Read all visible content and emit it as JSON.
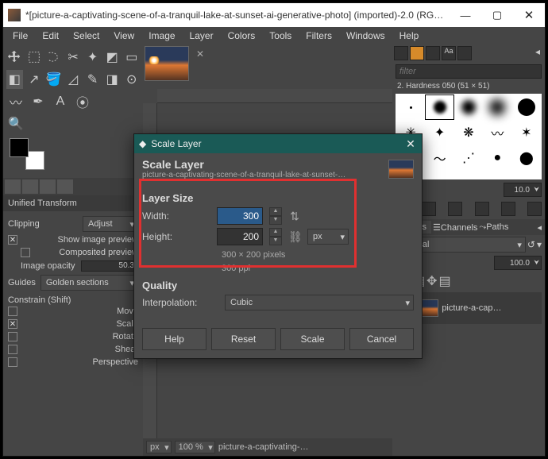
{
  "window": {
    "title": "*[picture-a-captivating-scene-of-a-tranquil-lake-at-sunset-ai-generative-photo] (imported)-2.0 (RG…"
  },
  "menu": [
    "File",
    "Edit",
    "Select",
    "View",
    "Image",
    "Layer",
    "Colors",
    "Tools",
    "Filters",
    "Windows",
    "Help"
  ],
  "tool_options": {
    "title": "Unified Transform",
    "clipping_label": "Clipping",
    "clipping_value": "Adjust",
    "show_preview": "Show image preview",
    "composited": "Composited preview",
    "opacity_label": "Image opacity",
    "opacity_value": "50.3",
    "guides_label": "Guides",
    "guides_value": "Golden sections",
    "constrain": "Constrain (Shift)",
    "c_move": "Move",
    "c_scale": "Scale",
    "c_rotate": "Rotate",
    "c_shear": "Shear",
    "c_persp": "Perspective"
  },
  "right": {
    "filter_placeholder": "filter",
    "brush_label": "2. Hardness 050 (51 × 51)",
    "brush_size": "10.0",
    "tabs": {
      "layers": "Layers",
      "channels": "Channels",
      "paths": "Paths"
    },
    "mode": "Normal",
    "opacity": "100.0",
    "layer_name": "picture-a-cap…"
  },
  "status": {
    "unit": "px",
    "zoom": "100 %",
    "filename": "picture-a-captivating-…"
  },
  "dialog": {
    "titlebar": "Scale Layer",
    "header_title": "Scale Layer",
    "header_sub": "picture-a-captivating-scene-of-a-tranquil-lake-at-sunset-ai-…",
    "layer_size": "Layer Size",
    "width_label": "Width:",
    "width_value": "300",
    "height_label": "Height:",
    "height_value": "200",
    "unit": "px",
    "dims": "300 × 200 pixels",
    "ppi": "300 ppi",
    "quality": "Quality",
    "interp_label": "Interpolation:",
    "interp_value": "Cubic",
    "buttons": {
      "help": "Help",
      "reset": "Reset",
      "scale": "Scale",
      "cancel": "Cancel"
    }
  }
}
